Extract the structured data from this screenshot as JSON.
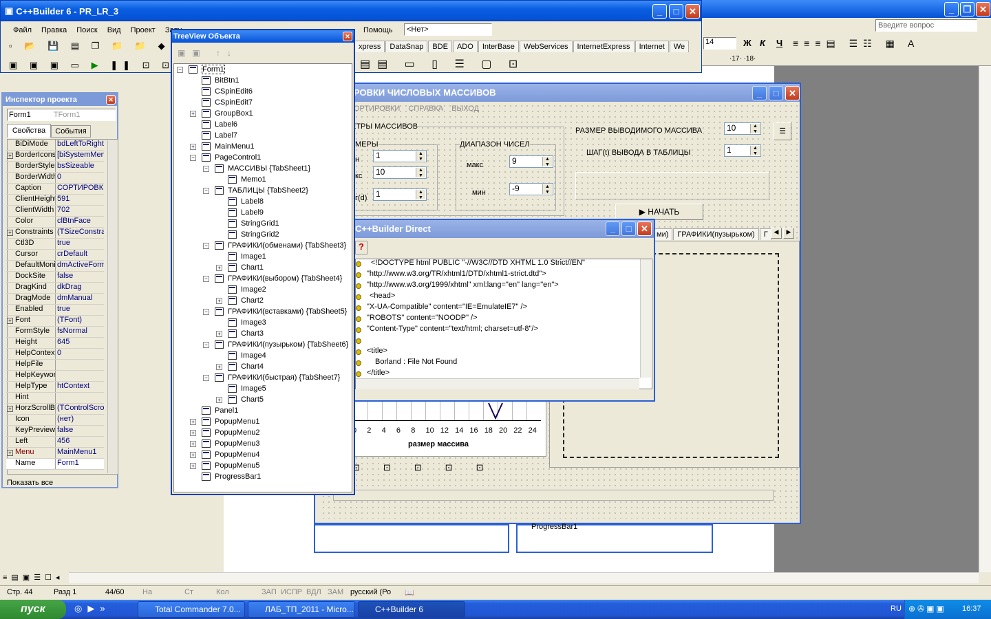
{
  "builder": {
    "title": "C++Builder 6 - PR_LR_3",
    "menu": [
      "Файл",
      "Правка",
      "Поиск",
      "Вид",
      "Проект",
      "Запу",
      "Помощь"
    ],
    "none_select": "<Нет>",
    "palette_tabs": [
      "xpress",
      "DataSnap",
      "BDE",
      "ADO",
      "InterBase",
      "WebServices",
      "InternetExpress",
      "Internet",
      "We"
    ]
  },
  "word": {
    "ask": "Введите вопрос",
    "font_size": "14",
    "bold": "Ж",
    "italic": "К",
    "underline": "Ч",
    "ruler": "·17· ·18·"
  },
  "inspector": {
    "title": "Инспектор проекта",
    "object": "Form1",
    "object_type": "TForm1",
    "tab_props": "Свойства",
    "tab_events": "События",
    "show_all": "Показать все",
    "props": [
      [
        "BiDiMode",
        "bdLeftToRight",
        ""
      ],
      [
        "BorderIcons",
        "[biSystemMenu",
        true
      ],
      [
        "BorderStyle",
        "bsSizeable",
        ""
      ],
      [
        "BorderWidth",
        "0",
        ""
      ],
      [
        "Caption",
        "СОРТИРОВКІ",
        ""
      ],
      [
        "ClientHeight",
        "591",
        ""
      ],
      [
        "ClientWidth",
        "702",
        ""
      ],
      [
        "Color",
        "clBtnFace",
        ""
      ],
      [
        "Constraints",
        "(TSizeConstrai",
        true
      ],
      [
        "Ctl3D",
        "true",
        ""
      ],
      [
        "Cursor",
        "crDefault",
        ""
      ],
      [
        "DefaultMoni",
        "dmActiveForm",
        ""
      ],
      [
        "DockSite",
        "false",
        ""
      ],
      [
        "DragKind",
        "dkDrag",
        ""
      ],
      [
        "DragMode",
        "dmManual",
        ""
      ],
      [
        "Enabled",
        "true",
        ""
      ],
      [
        "Font",
        "(TFont)",
        true
      ],
      [
        "FormStyle",
        "fsNormal",
        ""
      ],
      [
        "Height",
        "645",
        ""
      ],
      [
        "HelpContext",
        "0",
        ""
      ],
      [
        "HelpFile",
        "",
        ""
      ],
      [
        "HelpKeyword",
        "",
        ""
      ],
      [
        "HelpType",
        "htContext",
        ""
      ],
      [
        "Hint",
        "",
        ""
      ],
      [
        "HorzScrollB",
        "(TControlScroll",
        true
      ],
      [
        "Icon",
        "(нет)",
        ""
      ],
      [
        "KeyPreview",
        "false",
        ""
      ],
      [
        "Left",
        "456",
        ""
      ],
      [
        "Menu",
        "MainMenu1",
        true
      ],
      [
        "Name",
        "Form1",
        ""
      ]
    ]
  },
  "tree": {
    "title": "TreeView Объекта",
    "items": [
      {
        "t": "Form1",
        "l": 0,
        "e": "-"
      },
      {
        "t": "BitBtn1",
        "l": 1
      },
      {
        "t": "CSpinEdit6",
        "l": 1
      },
      {
        "t": "CSpinEdit7",
        "l": 1
      },
      {
        "t": "GroupBox1",
        "l": 1,
        "e": "+"
      },
      {
        "t": "Label6",
        "l": 1
      },
      {
        "t": "Label7",
        "l": 1
      },
      {
        "t": "MainMenu1",
        "l": 1,
        "e": "+"
      },
      {
        "t": "PageControl1",
        "l": 1,
        "e": "-"
      },
      {
        "t": "МАССИВЫ {TabSheet1}",
        "l": 2,
        "e": "-"
      },
      {
        "t": "Memo1",
        "l": 3
      },
      {
        "t": "ТАБЛИЦЫ {TabSheet2}",
        "l": 2,
        "e": "-"
      },
      {
        "t": "Label8",
        "l": 3
      },
      {
        "t": "Label9",
        "l": 3
      },
      {
        "t": "StringGrid1",
        "l": 3
      },
      {
        "t": "StringGrid2",
        "l": 3
      },
      {
        "t": "ГРАФИКИ(обменами) {TabSheet3}",
        "l": 2,
        "e": "-"
      },
      {
        "t": "Image1",
        "l": 3
      },
      {
        "t": "Chart1",
        "l": 3,
        "e": "+"
      },
      {
        "t": "ГРАФИКИ(выбором) {TabSheet4}",
        "l": 2,
        "e": "-"
      },
      {
        "t": "Image2",
        "l": 3
      },
      {
        "t": "Chart2",
        "l": 3,
        "e": "+"
      },
      {
        "t": "ГРАФИКИ(вставками) {TabSheet5}",
        "l": 2,
        "e": "-"
      },
      {
        "t": "Image3",
        "l": 3
      },
      {
        "t": "Chart3",
        "l": 3,
        "e": "+"
      },
      {
        "t": "ГРАФИКИ(пузырьком) {TabSheet6}",
        "l": 2,
        "e": "-"
      },
      {
        "t": "Image4",
        "l": 3
      },
      {
        "t": "Chart4",
        "l": 3,
        "e": "+"
      },
      {
        "t": "ГРАФИКИ(быстрая) {TabSheet7}",
        "l": 2,
        "e": "-"
      },
      {
        "t": "Image5",
        "l": 3
      },
      {
        "t": "Chart5",
        "l": 3,
        "e": "+"
      },
      {
        "t": "Panel1",
        "l": 1
      },
      {
        "t": "PopupMenu1",
        "l": 1,
        "e": "+"
      },
      {
        "t": "PopupMenu2",
        "l": 1,
        "e": "+"
      },
      {
        "t": "PopupMenu3",
        "l": 1,
        "e": "+"
      },
      {
        "t": "PopupMenu4",
        "l": 1,
        "e": "+"
      },
      {
        "t": "PopupMenu5",
        "l": 1,
        "e": "+"
      },
      {
        "t": "ProgressBar1",
        "l": 1
      }
    ]
  },
  "form": {
    "title": "РОВКИ ЧИСЛОВЫХ МАССИВОВ",
    "menu": [
      "ОРТИРОВКИ",
      "СПРАВКА",
      "ВЫХОД"
    ],
    "group_params": "ЕТРЫ МАССИВОВ",
    "group_sizes": "МЕРЫ",
    "size_label_a": "н",
    "size_label_b": "кс",
    "size_label_c": "г(d)",
    "size_vals": [
      "1",
      "10",
      "1"
    ],
    "group_range": "ДИАПАЗОН ЧИСЕЛ",
    "max_label": "макс",
    "max_val": "9",
    "min_label": "мин",
    "min_val": "-9",
    "out_size_label": "РАЗМЕР ВЫВОДИМОГО МАССИВА",
    "out_size_val": "10",
    "step_label": "ШАГ(t) ВЫВОДА В ТАБЛИЦЫ",
    "step_val": "1",
    "start": "НАЧАТЬ",
    "tab_a": "ми)",
    "tab_b": "ГРАФИКИ(пузырьком)",
    "tab_c": "Г",
    "x_ticks": [
      "0",
      "2",
      "4",
      "6",
      "8",
      "10",
      "12",
      "14",
      "16",
      "18",
      "20",
      "22",
      "24"
    ],
    "x_label": "размер массива",
    "bg_item": "ProgressBar1"
  },
  "direct": {
    "title": "C++Builder Direct",
    "lines": [
      "<!DOCTYPE html PUBLIC \"-//W3C//DTD XHTML 1.0 Strict//EN\"",
      "\"http://www.w3.org/TR/xhtml1/DTD/xhtml1-strict.dtd\">",
      "\"http://www.w3.org/1999/xhtml\" xml:lang=\"en\" lang=\"en\">",
      "<head>",
      "\"X-UA-Compatible\" content=\"IE=EmulateIE7\" />",
      "\"ROBOTS\" content=\"NOODP\" />",
      "\"Content-Type\" content=\"text/html; charset=utf-8\"/>",
      "",
      "<title>",
      "Borland : File Not Found",
      "</title>"
    ]
  },
  "status": {
    "page": "Стр. 44",
    "section": "Разд 1",
    "pages": "44/60",
    "at": "На",
    "line": "Ст",
    "col": "Кол",
    "rec": "ЗАП",
    "trk": "ИСПР",
    "ext": "ВДЛ",
    "ovr": "ЗАМ",
    "lang": "русский (Ро"
  },
  "taskbar": {
    "start": "пуск",
    "items": [
      "Total Commander 7.0...",
      "ЛАБ_ТП_2011 - Micro...",
      "C++Builder 6"
    ],
    "lang": "RU",
    "time": "16:37"
  }
}
